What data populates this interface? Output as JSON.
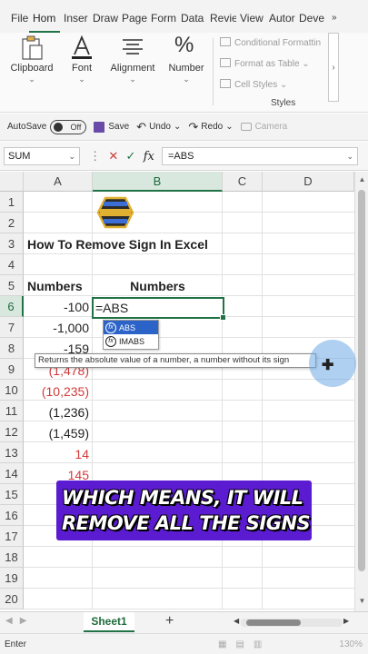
{
  "ribbon_tabs": [
    "File",
    "Hom",
    "Inser",
    "Draw",
    "Page",
    "Form",
    "Data",
    "Revie",
    "View",
    "Autor",
    "Deve"
  ],
  "ribbon_tab_more": "»",
  "ribbon_groups": {
    "clipboard": "Clipboard",
    "font": "Font",
    "alignment": "Alignment",
    "number": "Number",
    "styles": "Styles",
    "conditional_formatting": "Conditional Formattin",
    "format_as_table": "Format as Table",
    "cell_styles": "Cell Styles"
  },
  "quick_access": {
    "autosave_label": "AutoSave",
    "autosave_state": "Off",
    "save": "Save",
    "undo": "Undo",
    "redo": "Redo",
    "camera": "Camera"
  },
  "formula_bar": {
    "name_box": "SUM",
    "formula": "=ABS"
  },
  "columns": [
    "A",
    "B",
    "C",
    "D"
  ],
  "rows": [
    "1",
    "2",
    "3",
    "4",
    "5",
    "6",
    "7",
    "8",
    "9",
    "10",
    "11",
    "12",
    "13",
    "14",
    "15",
    "16",
    "17",
    "18",
    "19",
    "20"
  ],
  "cells": {
    "title": "How To Remove Sign In Excel",
    "header_a": "Numbers",
    "header_b": "Numbers",
    "a6": "-100",
    "a7": "-1,000",
    "a8": "-159",
    "a9": "(1,478)",
    "a10": "(10,235)",
    "a11": "(1,236)",
    "a12": "(1,459)",
    "a13": "14",
    "a14": "145",
    "b6": "=ABS"
  },
  "autocomplete": {
    "items": [
      "ABS",
      "IMABS"
    ],
    "tooltip": "Returns the absolute value of a number, a number without its sign"
  },
  "caption": [
    "WHICH MEANS, IT WILL",
    "REMOVE ALL THE SIGNS"
  ],
  "sheet_tab": "Sheet1",
  "add_sheet": "+",
  "status": {
    "mode": "Enter",
    "zoom": "130%"
  },
  "colors": {
    "accent": "#217346",
    "negative_red": "#d23a3a",
    "caption_bg": "#5b1bd0"
  }
}
